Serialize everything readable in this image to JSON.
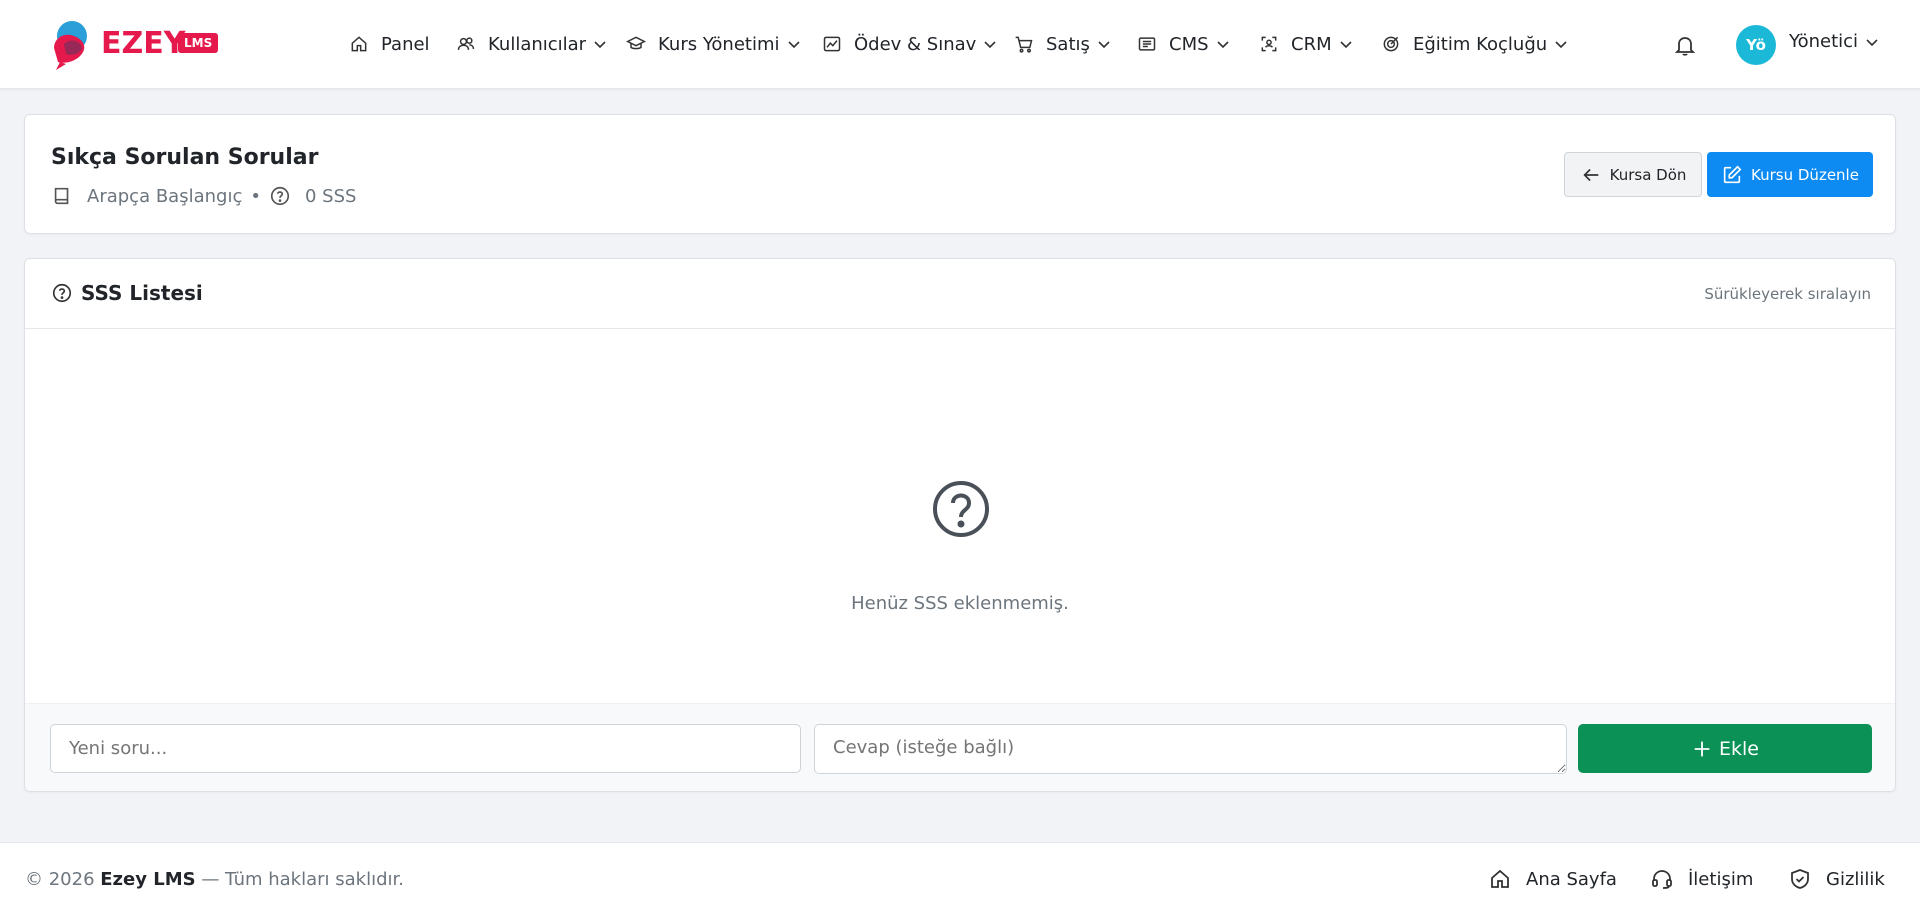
{
  "brand": {
    "name": "EZEY",
    "badge": "LMS"
  },
  "nav": {
    "items": [
      {
        "label": "Panel",
        "icon": "home-icon"
      },
      {
        "label": "Kullanıcılar",
        "icon": "users-icon"
      },
      {
        "label": "Kurs Yönetimi",
        "icon": "graduation-cap-icon"
      },
      {
        "label": "Ödev & Sınav",
        "icon": "image-chart-icon"
      },
      {
        "label": "Satış",
        "icon": "cart-icon"
      },
      {
        "label": "CMS",
        "icon": "newspaper-icon"
      },
      {
        "label": "CRM",
        "icon": "person-scan-icon"
      },
      {
        "label": "Eğitim Koçluğu",
        "icon": "target-icon"
      }
    ],
    "user": {
      "initials": "Yö",
      "name": "Yönetici"
    }
  },
  "header": {
    "title": "Sıkça Sorulan Sorular",
    "course": "Arapça Başlangıç",
    "separator": "•",
    "faq_count": "0 SSS",
    "back_label": "Kursa Dön",
    "edit_label": "Kursu Düzenle"
  },
  "list": {
    "title": "SSS Listesi",
    "hint": "Sürükleyerek sıralayın",
    "empty_text": "Henüz SSS eklenmemiş.",
    "question_placeholder": "Yeni soru...",
    "answer_placeholder": "Cevap (isteğe bağlı)",
    "add_label": "Ekle"
  },
  "footer": {
    "copy_prefix": "© 2026",
    "copy_brand": "Ezey LMS",
    "copy_suffix": "— Tüm hakları saklıdır.",
    "links": [
      "Ana Sayfa",
      "İletişim",
      "Gizlilik"
    ]
  },
  "colors": {
    "brand": "#e5194b",
    "primary": "#0d8bf2",
    "success": "#0b9156",
    "avatar": "#1bb8d8"
  }
}
